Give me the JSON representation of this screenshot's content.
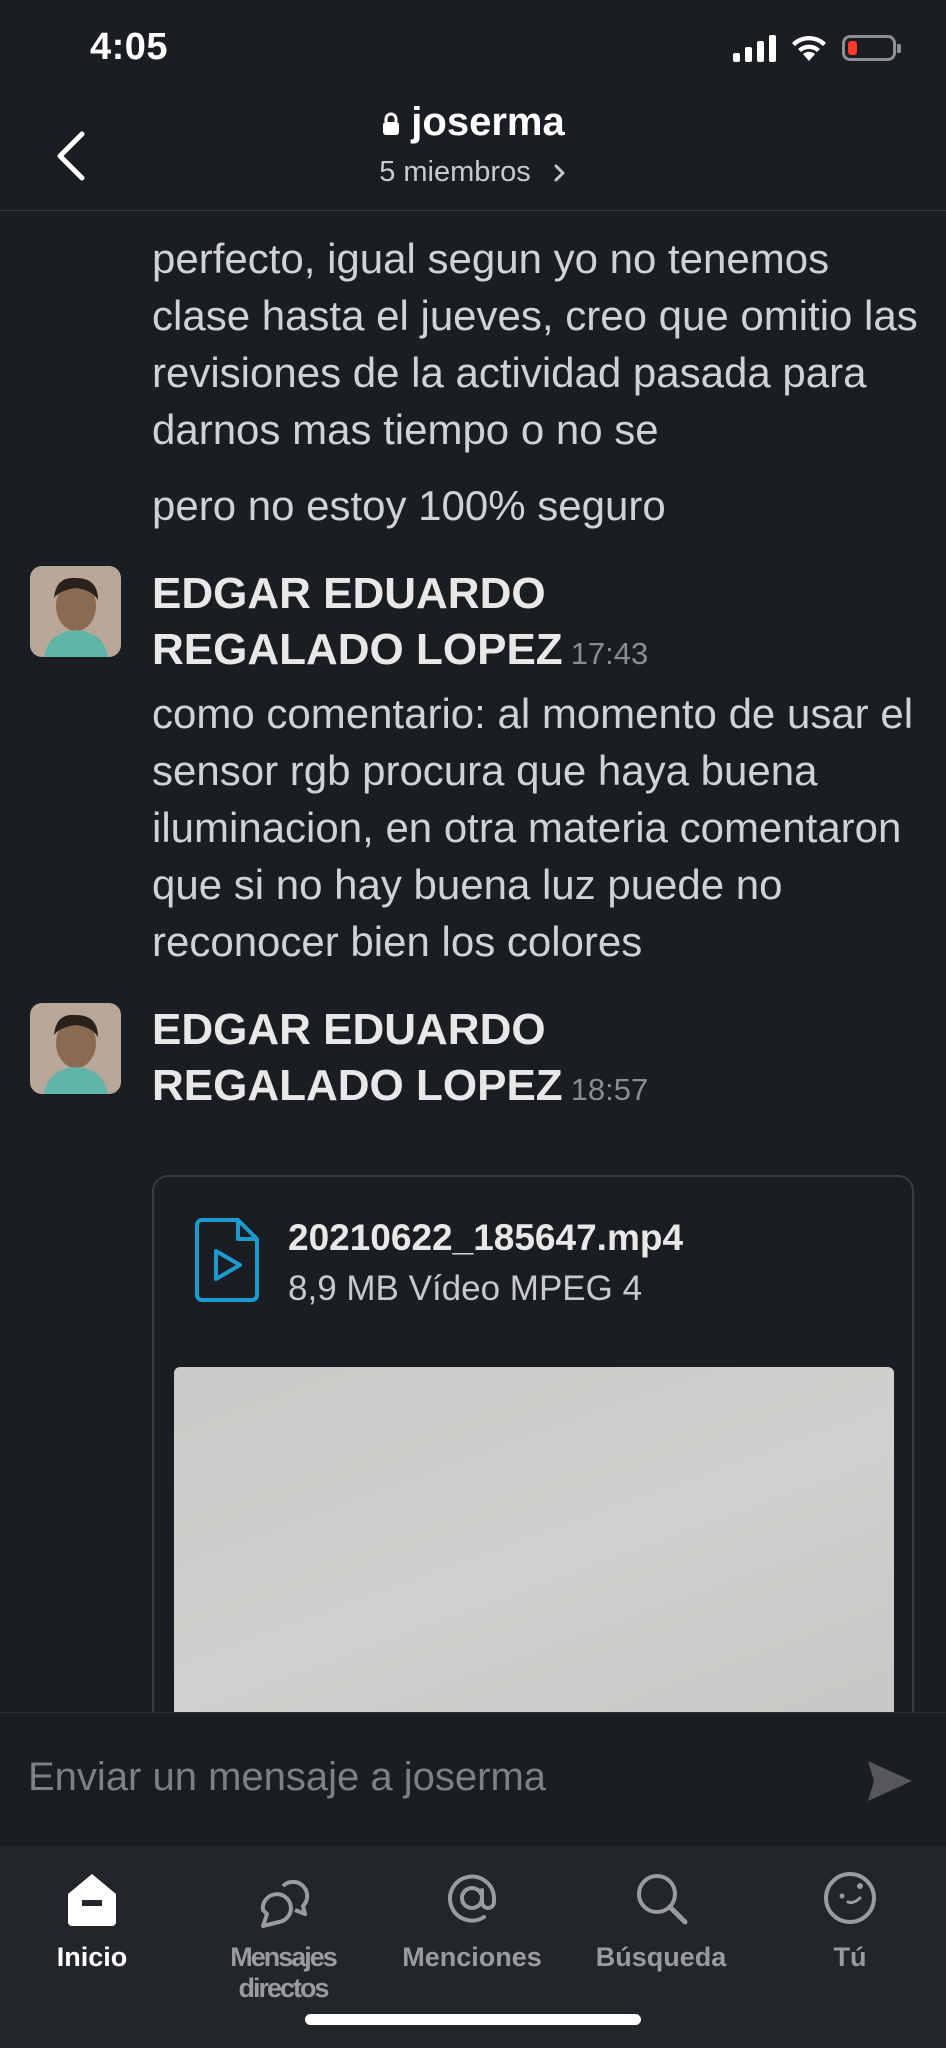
{
  "status_bar": {
    "time": "4:05"
  },
  "header": {
    "channel_name": "joserma",
    "members": "5 miembros"
  },
  "messages": {
    "continued_1": "perfecto, igual segun yo no tenemos clase hasta el jueves, creo que omitio las revisiones de la actividad pasada para darnos mas tiempo o no se",
    "continued_2": "pero no estoy 100% seguro",
    "msg_1": {
      "sender_line1": "EDGAR EDUARDO",
      "sender_line2": "REGALADO LOPEZ",
      "time": "17:43",
      "text": "como comentario: al momento de usar el sensor rgb procura que haya buena iluminacion, en otra materia comentaron que si no hay buena luz puede no reconocer bien los colores"
    },
    "msg_2": {
      "sender_line1": "EDGAR EDUARDO",
      "sender_line2": "REGALADO LOPEZ",
      "time": "18:57"
    }
  },
  "attachment": {
    "file_name": "20210622_185647.mp4",
    "file_meta": "8,9 MB Vídeo MPEG 4",
    "icon": "video-file-icon"
  },
  "composer": {
    "placeholder": "Enviar un mensaje a joserma"
  },
  "tabs": [
    {
      "label": "Inicio",
      "icon": "home-icon",
      "active": true
    },
    {
      "label": "Mensajes directos",
      "icon": "direct-messages-icon",
      "active": false
    },
    {
      "label": "Menciones",
      "icon": "at-sign-icon",
      "active": false
    },
    {
      "label": "Búsqueda",
      "icon": "search-icon",
      "active": false
    },
    {
      "label": "Tú",
      "icon": "profile-icon",
      "active": false
    }
  ],
  "colors": {
    "background": "#1a1d21",
    "tab_bar": "#222529",
    "file_icon": "#1d9bd1",
    "battery_low": "#ff3b30"
  }
}
